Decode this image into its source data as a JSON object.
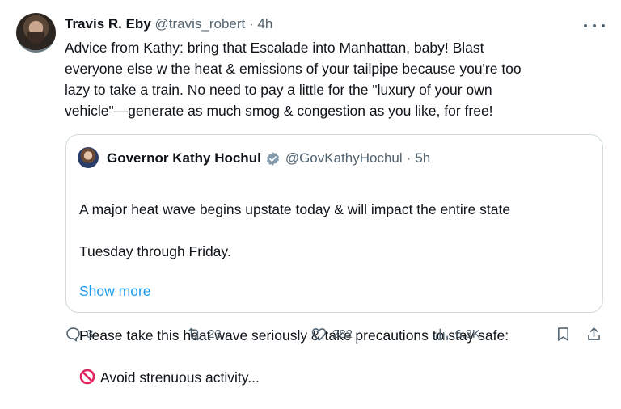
{
  "tweet": {
    "author_name": "Travis R. Eby",
    "handle": "@travis_robert",
    "separator": "·",
    "time": "4h",
    "text": "Advice from Kathy: bring that Escalade into Manhattan, baby! Blast\neveryone else w the heat & emissions of your tailpipe because you're too\nlazy to take a train. No need to pay a little for the \"luxury of your own\nvehicle\"—generate as much smog & congestion as you like, for free!"
  },
  "quoted": {
    "author_name": "Governor Kathy Hochul",
    "handle": "@GovKathyHochul",
    "separator": "·",
    "time": "5h",
    "line1": "A major heat wave begins upstate today & will impact the entire state",
    "line2": "Tuesday through Friday.",
    "line3": "Please take this heat wave seriously & take precautions to stay safe:",
    "line4": "Avoid strenuous activity...",
    "show_more": "Show more",
    "verified_color": "#829aab"
  },
  "actions": {
    "replies": "3",
    "reposts": "23",
    "likes": "282",
    "views": "6.3K"
  },
  "colors": {
    "text": "#0f1419",
    "muted": "#536471",
    "link": "#1d9bf0",
    "border": "#cfd9de",
    "prohibited": "#e0245e"
  }
}
